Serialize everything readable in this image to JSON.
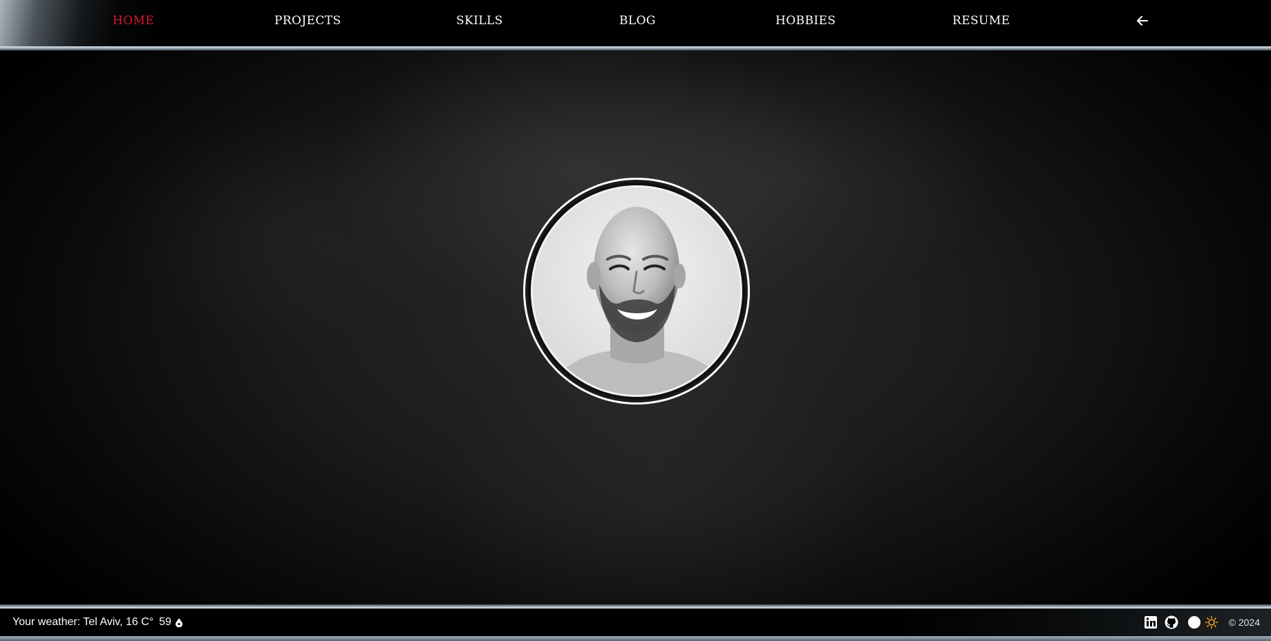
{
  "nav": {
    "items": [
      {
        "label": "HOME",
        "active": true
      },
      {
        "label": "PROJECTS",
        "active": false
      },
      {
        "label": "SKILLS",
        "active": false
      },
      {
        "label": "BLOG",
        "active": false
      },
      {
        "label": "HOBBIES",
        "active": false
      },
      {
        "label": "RESUME",
        "active": false
      }
    ],
    "back_icon": "arrow-left-icon",
    "active_color": "#d7182a"
  },
  "main": {
    "avatar_icon": "profile-photo"
  },
  "footer": {
    "weather_label": "Your weather: Tel Aviv, 16 C°",
    "air_quality": "59",
    "aqi_icon": "drop-icon",
    "moon_icon": "moon-icon",
    "linkedin_icon": "linkedin-icon",
    "github_icon": "github-icon",
    "theme_toggle_icon": "sun-icon",
    "copyright": "© 2024"
  }
}
